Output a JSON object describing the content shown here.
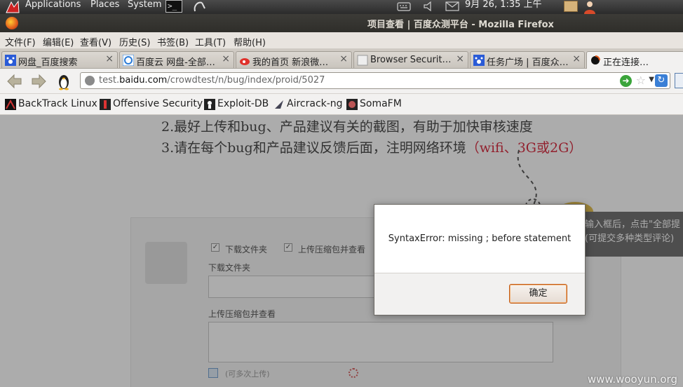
{
  "panel": {
    "applications": "Applications",
    "places": "Places",
    "system": "System",
    "terminal": ">_",
    "datetime": "9月 26, 1:35 上午"
  },
  "window": {
    "title": "项目查看 | 百度众测平台 - Mozilla Firefox"
  },
  "menubar": {
    "items": [
      "文件(F)",
      "编辑(E)",
      "查看(V)",
      "历史(S)",
      "书签(B)",
      "工具(T)",
      "帮助(H)"
    ]
  },
  "tabs": [
    {
      "label": "网盘_百度搜索",
      "icon": "baidu-paw-icon",
      "active": false
    },
    {
      "label": "百度云 网盘-全部…",
      "icon": "baidu-cloud-icon",
      "active": false
    },
    {
      "label": "我的首页 新浪微…",
      "icon": "weibo-icon",
      "active": false
    },
    {
      "label": "Browser Securit…",
      "icon": "blank-page-icon",
      "active": false
    },
    {
      "label": "任务广场 | 百度众…",
      "icon": "baidu-paw-icon",
      "active": false
    },
    {
      "label": "正在连接…",
      "icon": "loading-icon",
      "active": true
    }
  ],
  "urlbar": {
    "prefix": "test.",
    "domain": "baidu.com",
    "path": "/crowdtest/n/bug/index/proid/5027"
  },
  "bookmarks": [
    {
      "label": "BackTrack Linux",
      "icon": "backtrack-icon"
    },
    {
      "label": "Offensive Security",
      "icon": "offsec-icon"
    },
    {
      "label": "Exploit-DB",
      "icon": "exploit-db-icon"
    },
    {
      "label": "Aircrack-ng",
      "icon": "aircrack-icon"
    },
    {
      "label": "SomaFM",
      "icon": "somafm-icon"
    }
  ],
  "page": {
    "line2": "2.最好上传和bug、产品建议有关的截图，有助于加快审核速度",
    "line3_prefix": "3.请在每个bug和产品建议反馈后面，注明网络环境",
    "line3_red": "（wifi、3G或2G）",
    "checkbox1": "下载文件夹",
    "checkbox2": "上传压缩包并查看",
    "field1_label": "下载文件夹",
    "field2_label": "上传压缩包并查看",
    "upload_note": "(可多次上传)",
    "tooltip_line1": "输入框后，点击\"全部提",
    "tooltip_line2": "(可提交多种类型评论)"
  },
  "dialog": {
    "message": "SyntaxError: missing ; before statement",
    "ok_label": "确定"
  },
  "watermark": "www.wooyun.org",
  "colors": {
    "accent_red": "#d0021b",
    "ok_border": "#c25b15"
  }
}
